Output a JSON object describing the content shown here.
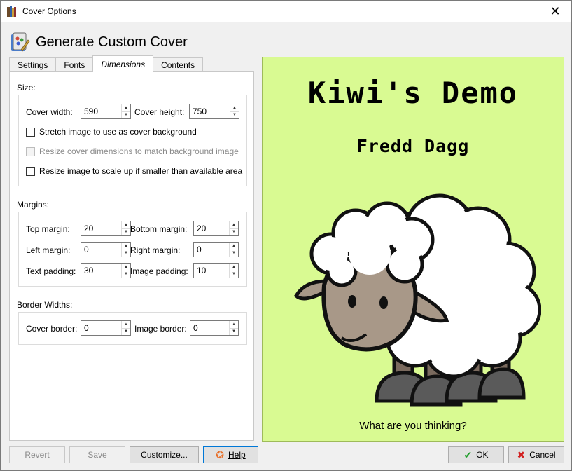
{
  "window": {
    "title": "Cover Options",
    "close_glyph": "✕"
  },
  "header": {
    "title": "Generate Custom Cover",
    "icon": "paint-palette-icon"
  },
  "tabs": [
    {
      "label": "Settings",
      "active": false
    },
    {
      "label": "Fonts",
      "active": false
    },
    {
      "label": "Dimensions",
      "active": true
    },
    {
      "label": "Contents",
      "active": false
    }
  ],
  "size": {
    "label": "Size:",
    "cover_width_label": "Cover width:",
    "cover_width": "590",
    "cover_height_label": "Cover height:",
    "cover_height": "750",
    "stretch_label": "Stretch image to use as cover background",
    "stretch_checked": false,
    "resize_cover_label": "Resize cover dimensions to match background image",
    "resize_cover_enabled": false,
    "resize_image_label": "Resize image to scale up if smaller than available area",
    "resize_image_checked": false
  },
  "margins": {
    "label": "Margins:",
    "top_label": "Top margin:",
    "top": "20",
    "bottom_label": "Bottom margin:",
    "bottom": "20",
    "left_label": "Left margin:",
    "left": "0",
    "right_label": "Right margin:",
    "right": "0",
    "text_padding_label": "Text padding:",
    "text_padding": "30",
    "image_padding_label": "Image padding:",
    "image_padding": "10"
  },
  "borders": {
    "label": "Border Widths:",
    "cover_label": "Cover border:",
    "cover": "0",
    "image_label": "Image border:",
    "image": "0"
  },
  "preview": {
    "title": "Kiwi's Demo",
    "author": "Fredd Dagg",
    "caption": "What are you thinking?",
    "background": "#d9fa92"
  },
  "buttons": {
    "revert": "Revert",
    "save": "Save",
    "customize": "Customize...",
    "help": "Help",
    "ok": "OK",
    "cancel": "Cancel"
  }
}
